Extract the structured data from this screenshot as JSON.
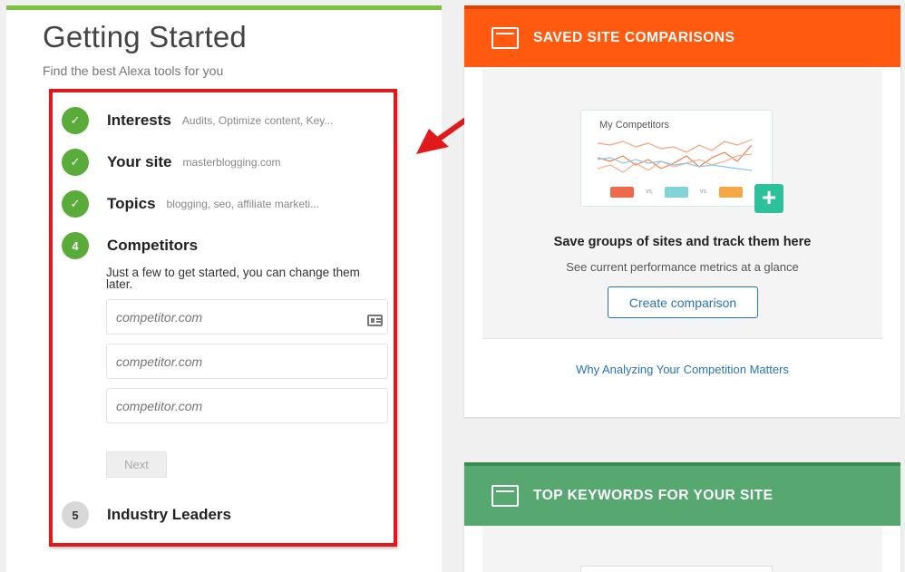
{
  "getting_started": {
    "title": "Getting Started",
    "subtitle": "Find the best Alexa tools for you",
    "steps": [
      {
        "marker": "✓",
        "label": "Interests",
        "detail": "Audits, Optimize content, Key..."
      },
      {
        "marker": "✓",
        "label": "Your site",
        "detail": "masterblogging.com"
      },
      {
        "marker": "✓",
        "label": "Topics",
        "detail": "blogging, seo, affiliate marketi..."
      },
      {
        "marker": "4",
        "label": "Competitors",
        "detail": "Just a few to get started, you can change them later."
      },
      {
        "marker": "5",
        "label": "Industry Leaders"
      }
    ],
    "competitor_inputs": [
      {
        "placeholder": "competitor.com",
        "value": ""
      },
      {
        "placeholder": "competitor.com",
        "value": ""
      },
      {
        "placeholder": "competitor.com",
        "value": ""
      }
    ],
    "next_label": "Next"
  },
  "saved_comparisons": {
    "header": "SAVED SITE COMPARISONS",
    "chart_title": "My Competitors",
    "vs_1": "vs",
    "vs_2": "vs",
    "plus": "+",
    "heading": "Save groups of sites and track them here",
    "subheading": "See current performance metrics at a glance",
    "create_label": "Create comparison",
    "link_text": "Why Analyzing Your Competition Matters"
  },
  "top_keywords": {
    "header": "TOP KEYWORDS FOR YOUR SITE"
  },
  "colors": {
    "step_green": "#5aac3a",
    "orange": "#ff5a10",
    "green_header": "#57a870",
    "highlight_red": "#e01a1a",
    "link_blue": "#2a73b8"
  }
}
